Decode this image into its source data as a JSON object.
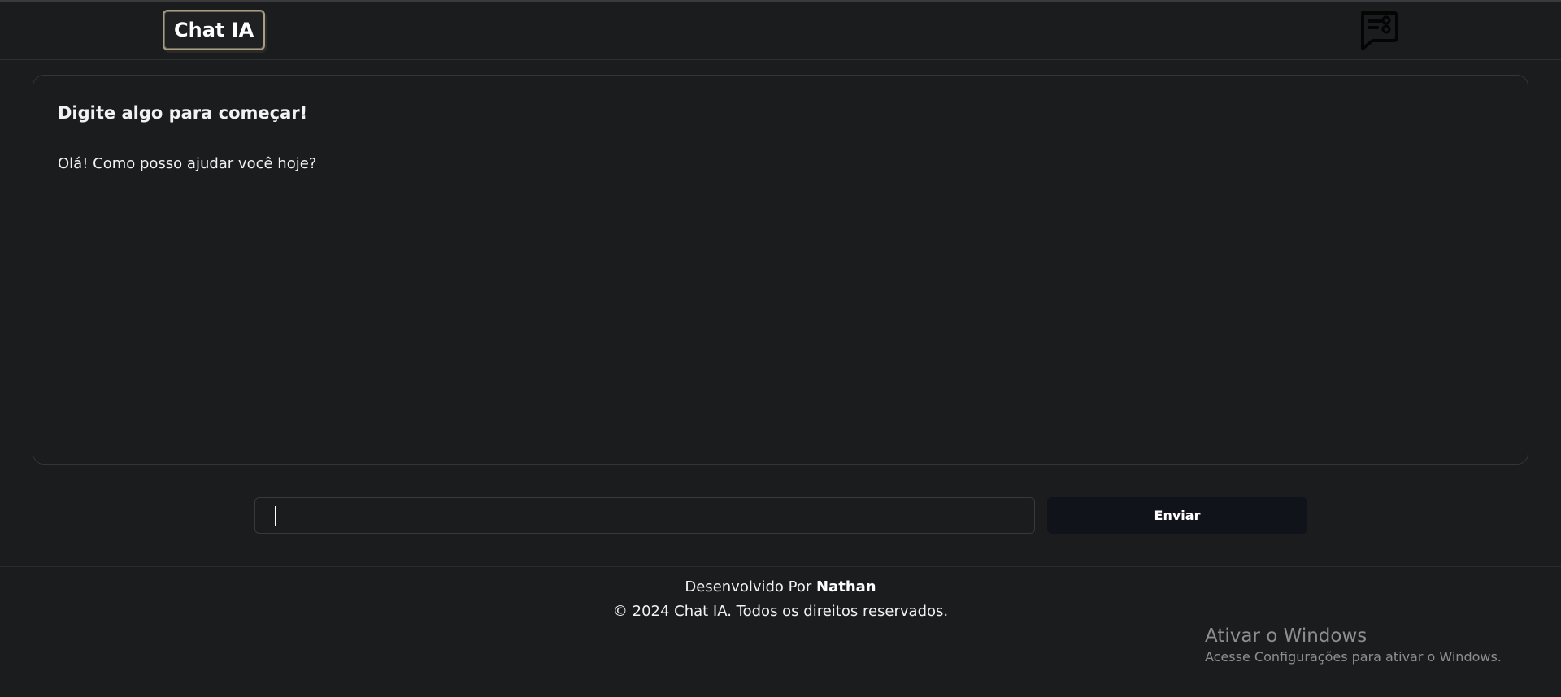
{
  "header": {
    "logo_text": "Chat IA",
    "icon": "chat-settings-icon"
  },
  "chat": {
    "title": "Digite algo para começar!",
    "messages": [
      "Olá! Como posso ajudar você hoje?"
    ]
  },
  "composer": {
    "input_value": "",
    "send_label": "Enviar"
  },
  "footer": {
    "developed_prefix": "Desenvolvido Por",
    "developer": "Nathan",
    "copyright": "© 2024 Chat IA. Todos os direitos reservados."
  },
  "windows_watermark": {
    "title": "Ativar o Windows",
    "subtitle": "Acesse Configurações para ativar o Windows."
  },
  "colors": {
    "background": "#1b1c1e",
    "logo_border": "#a89e86",
    "button_bg": "#10131a",
    "border": "#34353a"
  }
}
